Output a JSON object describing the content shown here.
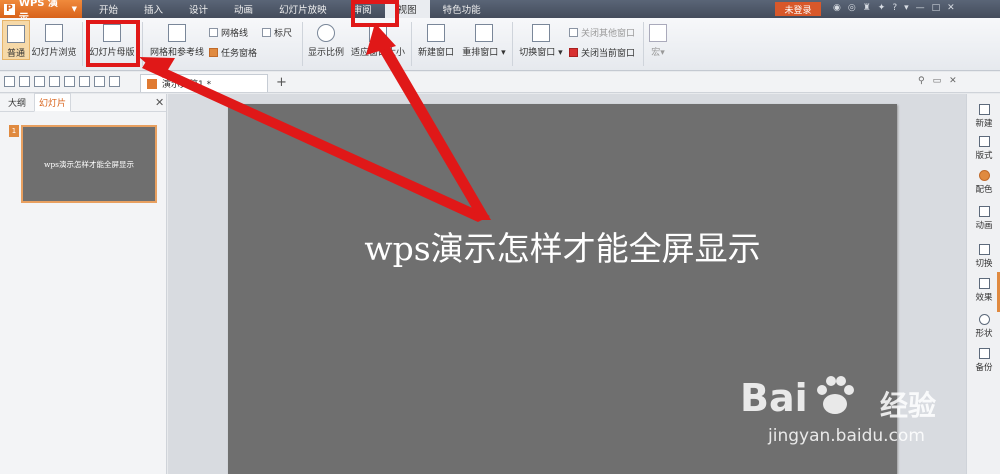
{
  "app": {
    "name": "WPS 演示",
    "login_label": "未登录"
  },
  "menu": [
    "开始",
    "插入",
    "设计",
    "动画",
    "幻灯片放映",
    "审阅",
    "视图",
    "特色功能"
  ],
  "active_menu": "视图",
  "ribbon": {
    "normal": "普通",
    "slide_sorter": "幻灯片浏览",
    "slide_master": "幻灯片母版",
    "grid_guides": "网格和参考线",
    "gridlines": "网格线",
    "ruler": "标尺",
    "task_pane": "任务窗格",
    "zoom": "显示比例",
    "fit_window": "适应窗口大小",
    "new_window": "新建窗口",
    "arrange": "重排窗口",
    "switch_window": "切换窗口",
    "close_other": "关闭其他窗口",
    "close_current": "关闭当前窗口",
    "macro": "宏"
  },
  "doc_tab": "演示文稿1 *",
  "panel_tabs": [
    "大纲",
    "幻灯片"
  ],
  "slides": [
    {
      "num": "1",
      "thumb_text": "wps演示怎样才能全屏显示"
    }
  ],
  "slide": {
    "title": "wps演示怎样才能全屏显示"
  },
  "right_sidebar": [
    "新建",
    "版式",
    "配色",
    "动画",
    "切换",
    "效果",
    "形状",
    "备份"
  ],
  "watermark": {
    "brand": "Bai",
    "brand2": "经验",
    "url": "jingyan.baidu.com"
  },
  "colors": {
    "accent": "#d8621a",
    "highlight": "#e01818",
    "slide_bg": "#6f6f6f"
  }
}
